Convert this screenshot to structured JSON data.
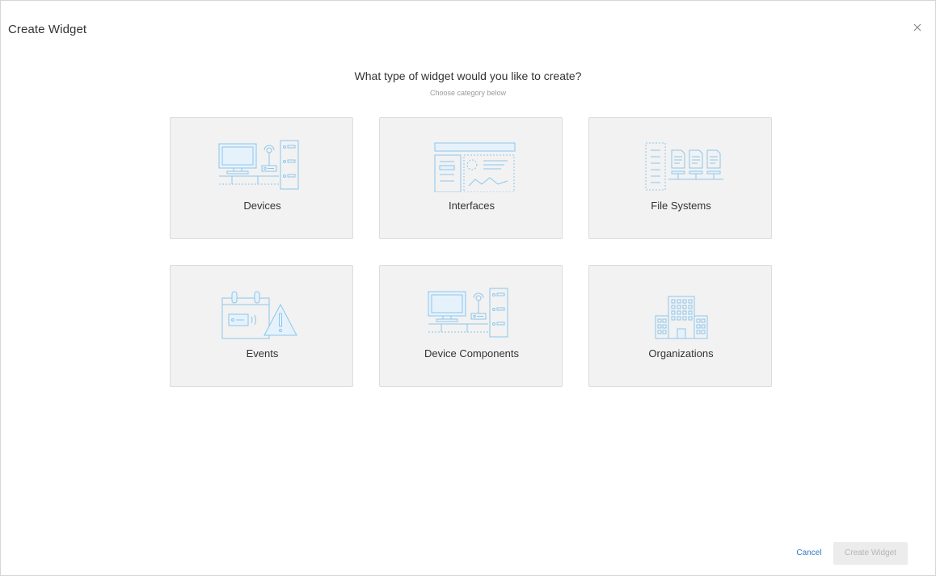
{
  "dialog": {
    "title": "Create Widget",
    "close_icon": "close-icon"
  },
  "prompt": {
    "heading": "What type of widget would you like to create?",
    "subheading": "Choose category below"
  },
  "categories": [
    {
      "label": "Devices",
      "icon": "devices-icon"
    },
    {
      "label": "Interfaces",
      "icon": "interfaces-icon"
    },
    {
      "label": "File Systems",
      "icon": "file-systems-icon"
    },
    {
      "label": "Events",
      "icon": "events-icon"
    },
    {
      "label": "Device Components",
      "icon": "device-components-icon"
    },
    {
      "label": "Organizations",
      "icon": "organizations-icon"
    }
  ],
  "footer": {
    "cancel_label": "Cancel",
    "create_label": "Create Widget"
  },
  "colors": {
    "accent": "#2f7bbf",
    "icon_stroke": "#8cc6ec",
    "card_bg": "#f2f2f2",
    "disabled_bg": "#ececec"
  }
}
